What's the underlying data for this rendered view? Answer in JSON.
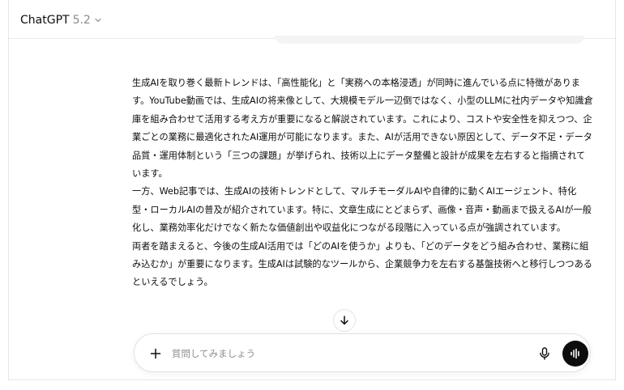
{
  "header": {
    "model_name": "ChatGPT",
    "model_version": "5.2"
  },
  "message": {
    "paragraphs": [
      "生成AIを取り巻く最新トレンドは、「高性能化」と「実務への本格浸透」が同時に進んでいる点に特徴があります。YouTube動画では、生成AIの将来像として、大規模モデル一辺倒ではなく、小型のLLMに社内データや知識倉庫を組み合わせて活用する考え方が重要になると解説されています。これにより、コストや安全性を抑えつつ、企業ごとの業務に最適化されたAI運用が可能になります。また、AIが活用できない原因として、データ不足・データ品質・運用体制という「三つの課題」が挙げられ、技術以上にデータ整備と設計が成果を左右すると指摘されています。",
      "一方、Web記事では、生成AIの技術トレンドとして、マルチモーダルAIや自律的に動くAIエージェント、特化型・ローカルAIの普及が紹介されています。特に、文章生成にとどまらず、画像・音声・動画まで扱えるAIが一般化し、業務効率化だけでなく新たな価値創出や収益化につながる段階に入っている点が強調されています。",
      "両者を踏まえると、今後の生成AI活用では「どのAIを使うか」よりも、「どのデータをどう組み合わせ、業務に組み込むか」が重要になります。生成AIは試験的なツールから、企業競争力を左右する基盤技術へと移行しつつあるといえるでしょう。"
    ]
  },
  "composer": {
    "placeholder": "質問してみましょう",
    "value": ""
  },
  "colors": {
    "text": "#0d0d0d",
    "muted": "#8a8a8a",
    "voice_button_bg": "#0d0d0d",
    "border": "#e2e2e2"
  },
  "icons": {
    "model_chevron": "chevron-down-icon",
    "scroll_down": "arrow-down-icon",
    "add": "plus-icon",
    "dictate": "microphone-icon",
    "voice_mode": "voice-waveform-icon"
  }
}
